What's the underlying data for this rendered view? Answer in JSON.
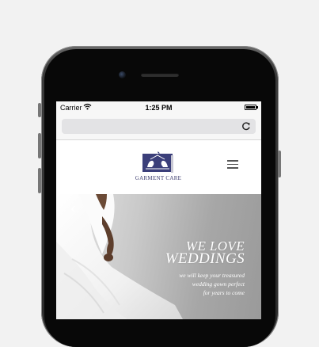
{
  "status_bar": {
    "carrier": "Carrier",
    "time": "1:25 PM"
  },
  "browser": {
    "reload_icon": "reload-icon"
  },
  "site": {
    "logo_text": "GARMENT CARE",
    "menu_icon": "hamburger-menu-icon"
  },
  "hero": {
    "headline_line1": "WE LOVE",
    "headline_line2": "WEDDINGS",
    "tagline_lines": [
      "we will keep your treasured",
      "wedding gown perfect",
      "for years to come"
    ],
    "arrow_icon": "chevron-left-icon"
  },
  "colors": {
    "brand_navy": "#3b3f7a",
    "hero_gray": "#a9a9a9",
    "phone_body": "#2a2a2a"
  }
}
